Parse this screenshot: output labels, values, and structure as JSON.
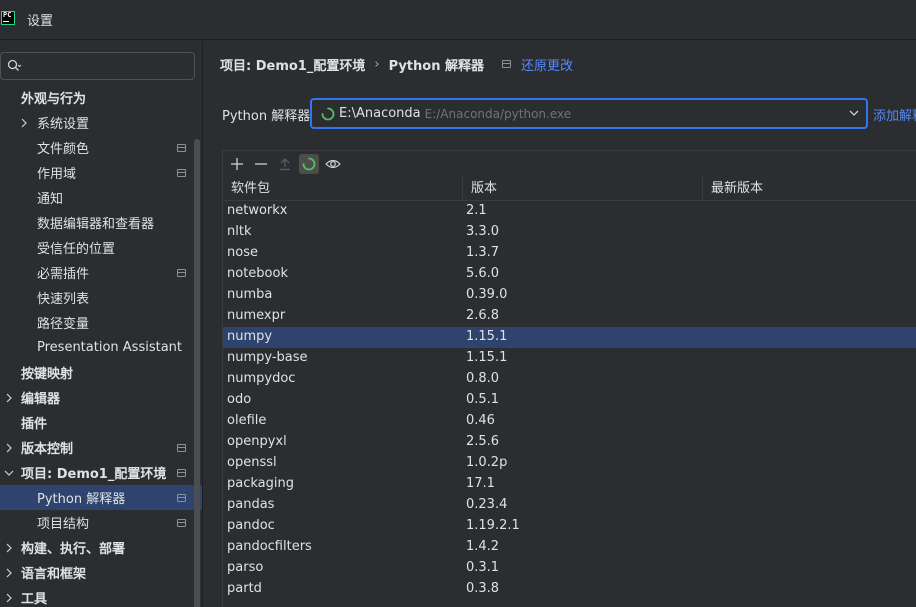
{
  "window": {
    "title": "设置",
    "logo_text": "PC"
  },
  "sidebar": {
    "search_placeholder": "",
    "items": [
      {
        "label": "外观与行为",
        "bold": true,
        "expandable": false,
        "indent": 1,
        "pin": false
      },
      {
        "label": "系统设置",
        "bold": false,
        "expandable": true,
        "indent": 2,
        "pin": false
      },
      {
        "label": "文件颜色",
        "bold": false,
        "expandable": false,
        "indent": 2,
        "pin": true
      },
      {
        "label": "作用域",
        "bold": false,
        "expandable": false,
        "indent": 2,
        "pin": true
      },
      {
        "label": "通知",
        "bold": false,
        "expandable": false,
        "indent": 2,
        "pin": false
      },
      {
        "label": "数据编辑器和查看器",
        "bold": false,
        "expandable": false,
        "indent": 2,
        "pin": false
      },
      {
        "label": "受信任的位置",
        "bold": false,
        "expandable": false,
        "indent": 2,
        "pin": false
      },
      {
        "label": "必需插件",
        "bold": false,
        "expandable": false,
        "indent": 2,
        "pin": true
      },
      {
        "label": "快速列表",
        "bold": false,
        "expandable": false,
        "indent": 2,
        "pin": false
      },
      {
        "label": "路径变量",
        "bold": false,
        "expandable": false,
        "indent": 2,
        "pin": false
      },
      {
        "label": "Presentation Assistant",
        "bold": false,
        "expandable": false,
        "indent": 2,
        "pin": false
      },
      {
        "label": "按键映射",
        "bold": true,
        "expandable": false,
        "indent": 1,
        "pin": false
      },
      {
        "label": "编辑器",
        "bold": true,
        "expandable": true,
        "indent": 1,
        "pin": false
      },
      {
        "label": "插件",
        "bold": true,
        "expandable": false,
        "indent": 1,
        "pin": false
      },
      {
        "label": "版本控制",
        "bold": true,
        "expandable": true,
        "indent": 1,
        "pin": true
      },
      {
        "label": "项目: Demo1_配置环境",
        "bold": true,
        "expandable": true,
        "expanded": true,
        "indent": 1,
        "pin": true
      },
      {
        "label": "Python 解释器",
        "bold": false,
        "expandable": false,
        "indent": 2,
        "pin": true,
        "selected": true
      },
      {
        "label": "项目结构",
        "bold": false,
        "expandable": false,
        "indent": 2,
        "pin": true
      },
      {
        "label": "构建、执行、部署",
        "bold": true,
        "expandable": true,
        "indent": 1,
        "pin": false
      },
      {
        "label": "语言和框架",
        "bold": true,
        "expandable": true,
        "indent": 1,
        "pin": false
      },
      {
        "label": "工具",
        "bold": true,
        "expandable": true,
        "indent": 1,
        "pin": false
      }
    ]
  },
  "main": {
    "breadcrumb": {
      "project": "项目: Demo1_配置环境",
      "separator": "›",
      "page": "Python 解释器",
      "reset_label": "还原更改"
    },
    "interpreter": {
      "label": "Python 解释器:",
      "name": "E:\\Anaconda",
      "path": "E:/Anaconda/python.exe",
      "add_label": "添加解释器"
    },
    "packages": {
      "columns": [
        "软件包",
        "版本",
        "最新版本"
      ],
      "rows": [
        {
          "name": "networkx",
          "version": "2.1"
        },
        {
          "name": "nltk",
          "version": "3.3.0"
        },
        {
          "name": "nose",
          "version": "1.3.7"
        },
        {
          "name": "notebook",
          "version": "5.6.0"
        },
        {
          "name": "numba",
          "version": "0.39.0"
        },
        {
          "name": "numexpr",
          "version": "2.6.8"
        },
        {
          "name": "numpy",
          "version": "1.15.1",
          "selected": true
        },
        {
          "name": "numpy-base",
          "version": "1.15.1"
        },
        {
          "name": "numpydoc",
          "version": "0.8.0"
        },
        {
          "name": "odo",
          "version": "0.5.1"
        },
        {
          "name": "olefile",
          "version": "0.46"
        },
        {
          "name": "openpyxl",
          "version": "2.5.6"
        },
        {
          "name": "openssl",
          "version": "1.0.2p"
        },
        {
          "name": "packaging",
          "version": "17.1"
        },
        {
          "name": "pandas",
          "version": "0.23.4"
        },
        {
          "name": "pandoc",
          "version": "1.19.2.1"
        },
        {
          "name": "pandocfilters",
          "version": "1.4.2"
        },
        {
          "name": "parso",
          "version": "0.3.1"
        },
        {
          "name": "partd",
          "version": "0.3.8"
        }
      ]
    }
  },
  "colors": {
    "background": "#2b2d30",
    "selection": "#2e436e",
    "accent": "#3574f0",
    "link": "#548af7",
    "text": "#dfe1e5",
    "muted": "#6f737a"
  }
}
